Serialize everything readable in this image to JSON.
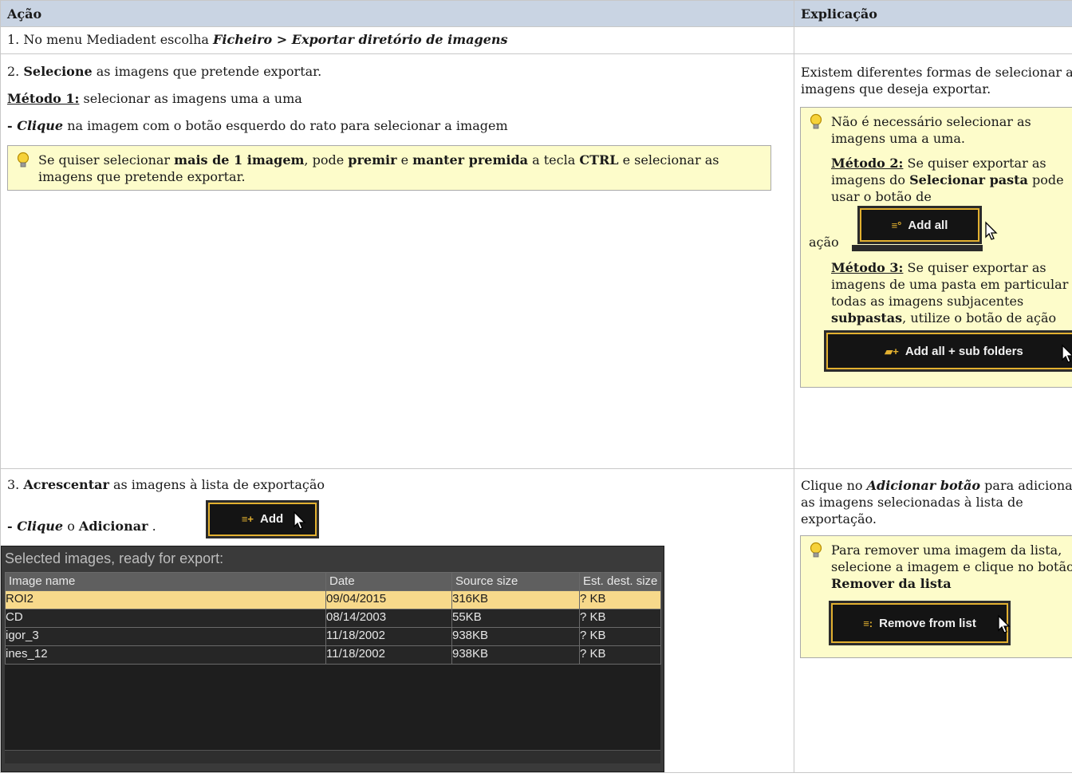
{
  "header": {
    "col1": "Ação",
    "col2": "Explicação"
  },
  "row1": {
    "num": "1.",
    "text": "No menu Mediadent escolha",
    "path": "Ficheiro > Exportar diretório de imagens"
  },
  "row2": {
    "num": "2.",
    "lead_bold": "Selecione",
    "lead_rest": "as imagens que pretende exportar.",
    "method1_label": "Método 1:",
    "method1_text": "selecionar as imagens uma a uma",
    "click_dash": "- ",
    "click_bold": "Clique",
    "click_rest": "na imagem com o botão esquerdo do rato para selecionar a imagem",
    "tip": {
      "t1": "Se quiser selecionar ",
      "b1": "mais de 1 imagem",
      "t2": ", pode ",
      "b2": "premir",
      "t3": " e ",
      "b3": "manter premida",
      "t4": " a tecla ",
      "b4": "CTRL",
      "t5": " e selecionar as imagens que pretende exportar."
    },
    "explain": "Existem diferentes formas de selecionar as imagens que deseja exportar.",
    "tip2": {
      "intro": "Não é necessário selecionar as imagens uma a uma.",
      "m2_label": "Método 2:",
      "m2_t1": " Se quiser exportar as imagens do ",
      "m2_b1": "Selecionar pasta",
      "m2_t2": " pode usar o botão de",
      "m2_t3": "ação",
      "btn_add_all": "Add all",
      "m3_label": "Método 3:",
      "m3_t1": " Se quiser exportar as imagens de uma pasta em particular e todas as imagens subjacentes ",
      "m3_b1": "subpastas",
      "m3_t2": ", utilize o botão de ação",
      "btn_add_all_sub": "Add all + sub folders"
    }
  },
  "row3": {
    "num": "3.",
    "lead_bold": "Acrescentar",
    "lead_rest": "as imagens à lista de exportação",
    "click_dash": "- ",
    "click_bold": "Clique",
    "click_mid": " o ",
    "click_bold2": "Adicionar",
    "click_end": " .",
    "btn_add": "Add",
    "export_list": {
      "title": "Selected images, ready for export:",
      "columns": [
        "Image name",
        "Date",
        "Source size",
        "Est. dest. size"
      ],
      "rows": [
        [
          "ROI2",
          "09/04/2015",
          "316KB",
          "? KB"
        ],
        [
          "CD",
          "08/14/2003",
          "55KB",
          "? KB"
        ],
        [
          "igor_3",
          "11/18/2002",
          "938KB",
          "? KB"
        ],
        [
          "ines_12",
          "11/18/2002",
          "938KB",
          "? KB"
        ]
      ],
      "selected_row": 0
    },
    "explain_t1": "Clique no ",
    "explain_bi": "Adicionar botão",
    "explain_t2": " para adicionar as imagens selecionadas à lista de exportação.",
    "tip": {
      "t1": "Para remover uma imagem da lista, selecione a imagem e clique no botão ",
      "b1": "Remover da lista",
      "btn_remove": "Remove from list"
    }
  },
  "colors": {
    "header_bg": "#c9d4e3",
    "tip_bg": "#fdfcca",
    "button_border": "#e2b030",
    "selected_row": "#f7d98b"
  }
}
